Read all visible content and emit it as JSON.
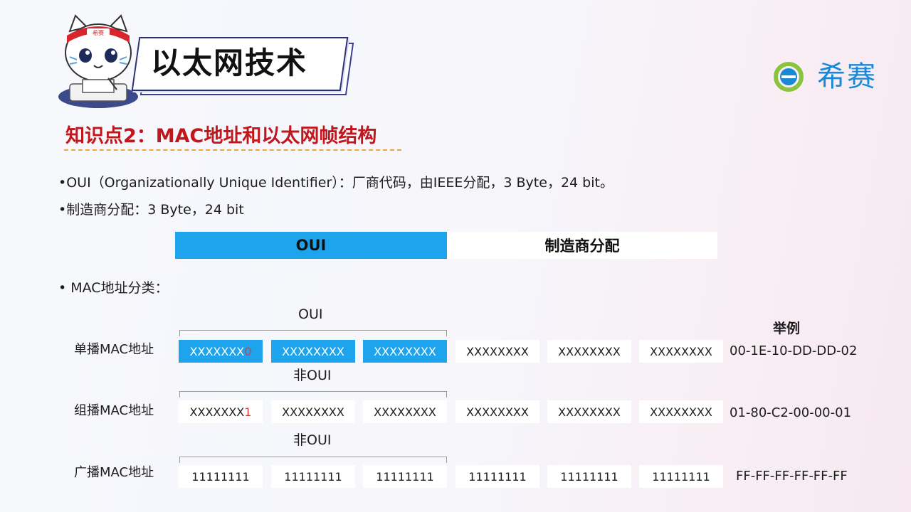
{
  "header": {
    "title": "以太网技术",
    "mascot_badge": "希赛",
    "logo_text": "希赛",
    "logo_mark": "e"
  },
  "knowledge_point": {
    "title": "知识点2：MAC地址和以太网帧结构"
  },
  "bullets": [
    "•OUI（Organizationally Unique Identifier）：厂商代码，由IEEE分配，3 Byte，24 bit。",
    "•制造商分配：3 Byte，24 bit"
  ],
  "structure_bar": {
    "oui_label": "OUI",
    "manufacturer_label": "制造商分配"
  },
  "classification": {
    "heading": "•   MAC地址分类：",
    "example_heading": "举例",
    "rows": [
      {
        "group_label": "OUI",
        "label": "单播MAC地址",
        "first_prefix": "XXXXXXX",
        "first_bit": "0",
        "cells": [
          "XXXXXXXX",
          "XXXXXXXX",
          "XXXXXXXX",
          "XXXXXXXX",
          "XXXXXXXX"
        ],
        "example": "00-1E-10-DD-DD-02"
      },
      {
        "group_label": "非OUI",
        "label": "组播MAC地址",
        "first_prefix": "XXXXXXX",
        "first_bit": "1",
        "cells": [
          "XXXXXXXX",
          "XXXXXXXX",
          "XXXXXXXX",
          "XXXXXXXX",
          "XXXXXXXX"
        ],
        "example": "01-80-C2-00-00-01"
      },
      {
        "group_label": "非OUI",
        "label": "广播MAC地址",
        "first_prefix": "11111111",
        "first_bit": "",
        "cells": [
          "11111111",
          "11111111",
          "11111111",
          "11111111",
          "11111111"
        ],
        "example": "FF-FF-FF-FF-FF-FF"
      }
    ]
  },
  "colors": {
    "accent_blue": "#1da4ec",
    "title_red": "#c0161c",
    "bit_red": "#e0393e",
    "underline_orange": "#f0a23c"
  }
}
